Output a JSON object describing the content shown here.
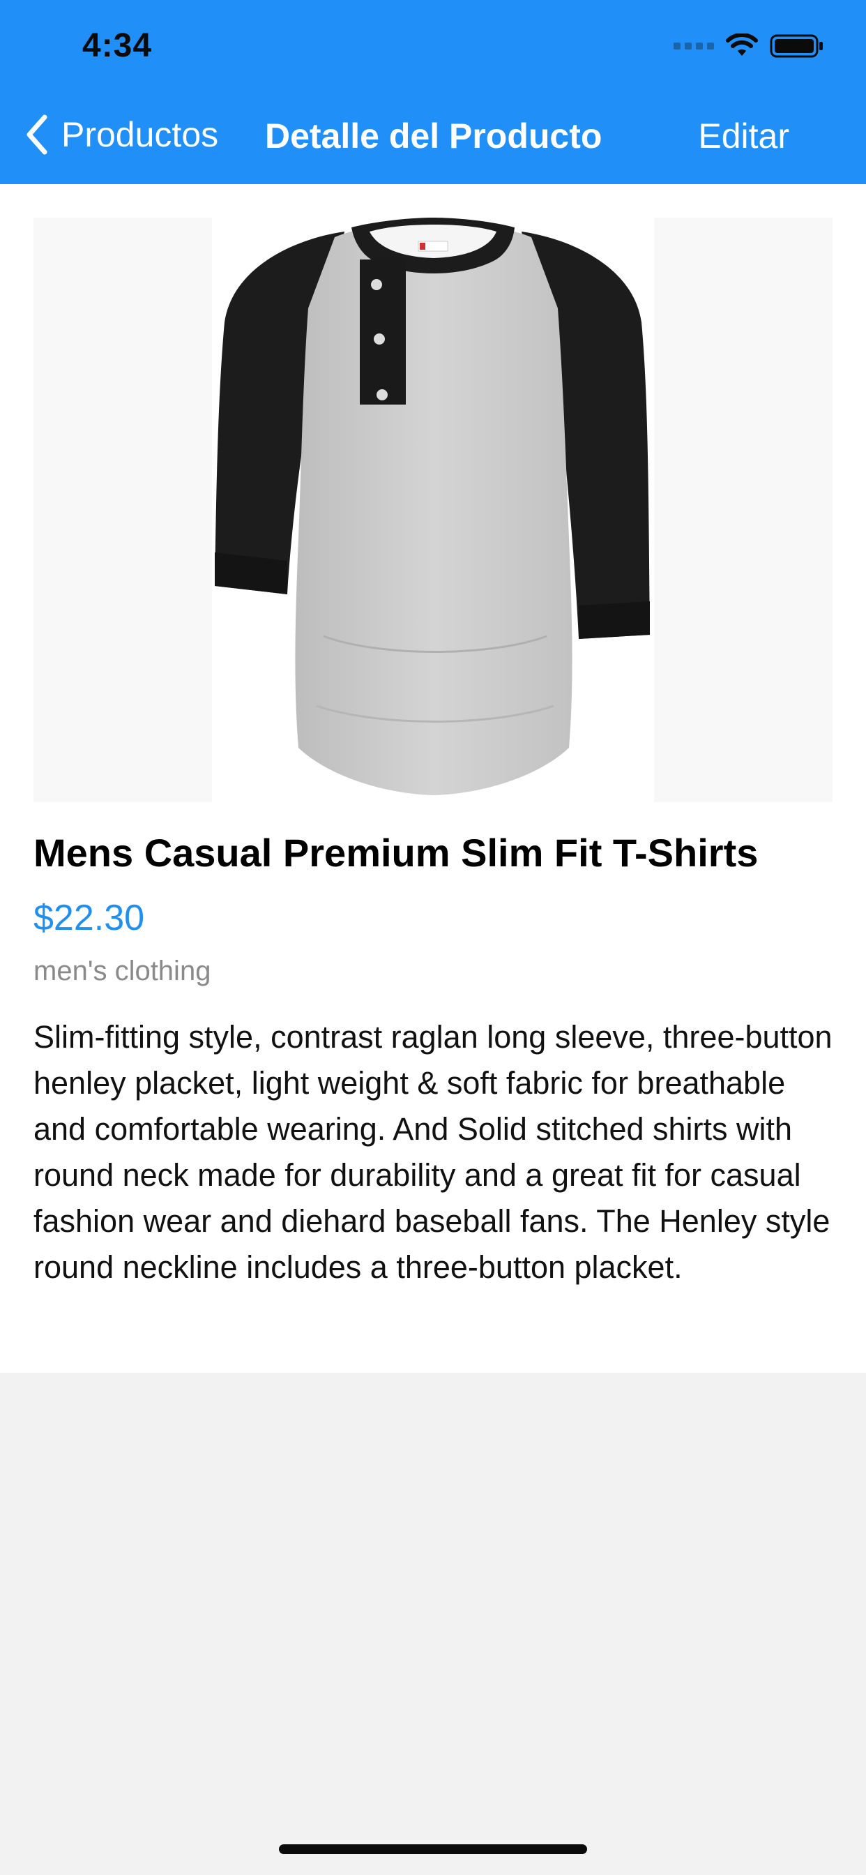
{
  "status_bar": {
    "time": "4:34"
  },
  "nav_bar": {
    "back_label": "Productos",
    "title": "Detalle del Producto",
    "edit_label": "Editar"
  },
  "product": {
    "title": "Mens Casual Premium Slim Fit T-Shirts",
    "price": "$22.30",
    "category": "men's clothing",
    "description": "Slim-fitting style, contrast raglan long sleeve, three-button henley placket, light weight & soft fabric for breathable and comfortable wearing. And Solid stitched shirts with round neck made for durability and a great fit for casual fashion wear and diehard baseball fans. The Henley style round neckline includes a three-button placket."
  },
  "icons": {
    "back": "chevron-left-icon",
    "wifi": "wifi-icon",
    "battery": "battery-icon",
    "signal": "cellular-signal-icon"
  },
  "colors": {
    "accent": "#2090f8",
    "price": "#2090f0",
    "category": "#8a8a8a",
    "background": "#f2f2f2"
  }
}
